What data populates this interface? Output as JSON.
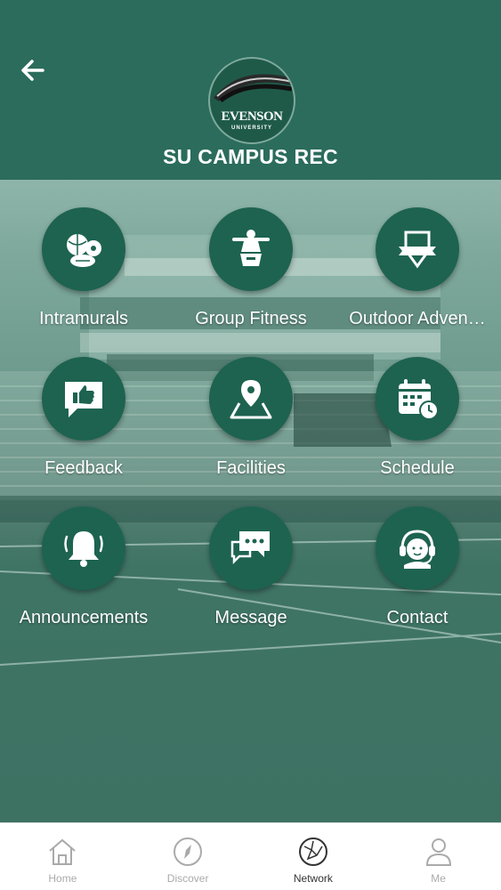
{
  "header": {
    "title": "SU CAMPUS REC",
    "logo_text": "EVENSON",
    "logo_subtext": "UNIVERSITY",
    "back_icon": "arrow-left-icon"
  },
  "tiles": [
    {
      "label": "Intramurals",
      "icon": "sports-balls-icon"
    },
    {
      "label": "Group Fitness",
      "icon": "weightlifter-icon"
    },
    {
      "label": "Outdoor Adven…",
      "icon": "shield-banner-icon"
    },
    {
      "label": "Feedback",
      "icon": "thumbs-up-chat-icon"
    },
    {
      "label": "Facilities",
      "icon": "map-pin-icon"
    },
    {
      "label": "Schedule",
      "icon": "calendar-clock-icon"
    },
    {
      "label": "Announcements",
      "icon": "bell-icon"
    },
    {
      "label": "Message",
      "icon": "chat-bubbles-icon"
    },
    {
      "label": "Contact",
      "icon": "headset-support-icon"
    }
  ],
  "tabbar": {
    "items": [
      {
        "label": "Home",
        "icon": "home-icon",
        "active": false
      },
      {
        "label": "Discover",
        "icon": "compass-icon",
        "active": false
      },
      {
        "label": "Network",
        "icon": "network-globe-icon",
        "active": true
      },
      {
        "label": "Me",
        "icon": "person-icon",
        "active": false
      }
    ]
  },
  "colors": {
    "header": "#2b6c5c",
    "tile_circle": "#1d6350",
    "tab_active": "#333333",
    "tab_inactive": "#aaaaaa"
  }
}
